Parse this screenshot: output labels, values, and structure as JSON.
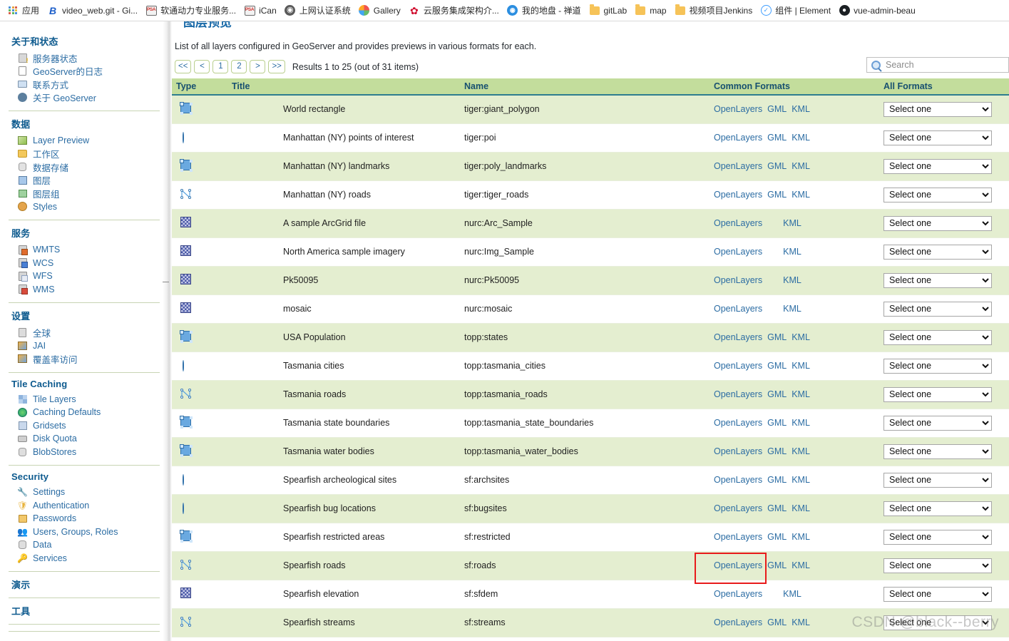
{
  "browser": {
    "bookmarks": [
      {
        "label": "应用",
        "icon": "apps-grid-icon"
      },
      {
        "label": "video_web.git - Gi...",
        "icon": "bitbucket-icon"
      },
      {
        "label": "软通动力专业服务...",
        "icon": "psa-icon"
      },
      {
        "label": "iCan",
        "icon": "psa-icon"
      },
      {
        "label": "上网认证系统",
        "icon": "globe-icon"
      },
      {
        "label": "Gallery",
        "icon": "gallery-icon"
      },
      {
        "label": "云服务集成架构介...",
        "icon": "huawei-icon"
      },
      {
        "label": "我的地盘 - 禅道",
        "icon": "chandao-icon"
      },
      {
        "label": "gitLab",
        "icon": "folder-icon"
      },
      {
        "label": "map",
        "icon": "folder-icon"
      },
      {
        "label": "视频项目Jenkins",
        "icon": "folder-icon"
      },
      {
        "label": "组件 | Element",
        "icon": "element-icon"
      },
      {
        "label": "vue-admin-beau",
        "icon": "github-icon"
      }
    ]
  },
  "sidebar": {
    "groups": [
      {
        "heading": "关于和状态",
        "items": [
          {
            "label": "服务器状态",
            "icon": "server-status-icon"
          },
          {
            "label": "GeoServer的日志",
            "icon": "document-icon"
          },
          {
            "label": "联系方式",
            "icon": "contact-card-icon"
          },
          {
            "label": "关于 GeoServer",
            "icon": "about-info-icon"
          }
        ]
      },
      {
        "heading": "数据",
        "items": [
          {
            "label": "Layer Preview",
            "icon": "layer-preview-icon"
          },
          {
            "label": "工作区",
            "icon": "workspace-folder-icon"
          },
          {
            "label": "数据存储",
            "icon": "datastore-icon"
          },
          {
            "label": "图层",
            "icon": "layer-icon"
          },
          {
            "label": "图层组",
            "icon": "layer-group-icon"
          },
          {
            "label": "Styles",
            "icon": "styles-palette-icon"
          }
        ]
      },
      {
        "heading": "服务",
        "items": [
          {
            "label": "WMTS",
            "icon": "service-wmts-icon"
          },
          {
            "label": "WCS",
            "icon": "service-wcs-icon"
          },
          {
            "label": "WFS",
            "icon": "service-wfs-icon"
          },
          {
            "label": "WMS",
            "icon": "service-wms-icon"
          }
        ]
      },
      {
        "heading": "设置",
        "items": [
          {
            "label": "全球",
            "icon": "global-settings-icon"
          },
          {
            "label": "JAI",
            "icon": "jai-icon"
          },
          {
            "label": "覆盖率访问",
            "icon": "coverage-access-icon"
          }
        ]
      },
      {
        "heading": "Tile Caching",
        "items": [
          {
            "label": "Tile Layers",
            "icon": "tile-layers-icon"
          },
          {
            "label": "Caching Defaults",
            "icon": "caching-defaults-icon"
          },
          {
            "label": "Gridsets",
            "icon": "gridsets-icon"
          },
          {
            "label": "Disk Quota",
            "icon": "disk-quota-icon"
          },
          {
            "label": "BlobStores",
            "icon": "blobstores-icon"
          }
        ]
      },
      {
        "heading": "Security",
        "items": [
          {
            "label": "Settings",
            "icon": "wrench-icon"
          },
          {
            "label": "Authentication",
            "icon": "shield-icon"
          },
          {
            "label": "Passwords",
            "icon": "lock-icon"
          },
          {
            "label": "Users, Groups, Roles",
            "icon": "users-icon"
          },
          {
            "label": "Data",
            "icon": "data-key-icon"
          },
          {
            "label": "Services",
            "icon": "services-key-icon"
          }
        ]
      },
      {
        "heading": "演示",
        "items": []
      },
      {
        "heading": "工具",
        "items": []
      }
    ]
  },
  "main": {
    "page_title": "图层预览",
    "description": "List of all layers configured in GeoServer and provides previews in various formats for each.",
    "pager": {
      "first": "<<",
      "prev": "<",
      "page1": "1",
      "page2": "2",
      "next": ">",
      "last": ">>",
      "results_text": "Results 1 to 25 (out of 31 items)"
    },
    "search": {
      "placeholder": "Search",
      "value": ""
    },
    "table": {
      "headers": [
        "Type",
        "Title",
        "Name",
        "Common Formats",
        "All Formats"
      ],
      "select_placeholder": "Select one",
      "rows": [
        {
          "type": "polygon",
          "title": "World rectangle",
          "name": "tiger:giant_polygon",
          "formats": [
            "OpenLayers",
            "GML",
            "KML"
          ],
          "select": "Select one"
        },
        {
          "type": "point",
          "title": "Manhattan (NY) points of interest",
          "name": "tiger:poi",
          "formats": [
            "OpenLayers",
            "GML",
            "KML"
          ],
          "select": "Select one"
        },
        {
          "type": "polygon",
          "title": "Manhattan (NY) landmarks",
          "name": "tiger:poly_landmarks",
          "formats": [
            "OpenLayers",
            "GML",
            "KML"
          ],
          "select": "Select one"
        },
        {
          "type": "line",
          "title": "Manhattan (NY) roads",
          "name": "tiger:tiger_roads",
          "formats": [
            "OpenLayers",
            "GML",
            "KML"
          ],
          "select": "Select one"
        },
        {
          "type": "raster",
          "title": "A sample ArcGrid file",
          "name": "nurc:Arc_Sample",
          "formats": [
            "OpenLayers",
            "KML"
          ],
          "select": "Select one"
        },
        {
          "type": "raster",
          "title": "North America sample imagery",
          "name": "nurc:Img_Sample",
          "formats": [
            "OpenLayers",
            "KML"
          ],
          "select": "Select one"
        },
        {
          "type": "raster",
          "title": "Pk50095",
          "name": "nurc:Pk50095",
          "formats": [
            "OpenLayers",
            "KML"
          ],
          "select": "Select one"
        },
        {
          "type": "raster",
          "title": "mosaic",
          "name": "nurc:mosaic",
          "formats": [
            "OpenLayers",
            "KML"
          ],
          "select": "Select one"
        },
        {
          "type": "polygon",
          "title": "USA Population",
          "name": "topp:states",
          "formats": [
            "OpenLayers",
            "GML",
            "KML"
          ],
          "select": "Select one"
        },
        {
          "type": "point",
          "title": "Tasmania cities",
          "name": "topp:tasmania_cities",
          "formats": [
            "OpenLayers",
            "GML",
            "KML"
          ],
          "select": "Select one"
        },
        {
          "type": "line",
          "title": "Tasmania roads",
          "name": "topp:tasmania_roads",
          "formats": [
            "OpenLayers",
            "GML",
            "KML"
          ],
          "select": "Select one"
        },
        {
          "type": "polygon",
          "title": "Tasmania state boundaries",
          "name": "topp:tasmania_state_boundaries",
          "formats": [
            "OpenLayers",
            "GML",
            "KML"
          ],
          "select": "Select one"
        },
        {
          "type": "polygon",
          "title": "Tasmania water bodies",
          "name": "topp:tasmania_water_bodies",
          "formats": [
            "OpenLayers",
            "GML",
            "KML"
          ],
          "select": "Select one"
        },
        {
          "type": "point",
          "title": "Spearfish archeological sites",
          "name": "sf:archsites",
          "formats": [
            "OpenLayers",
            "GML",
            "KML"
          ],
          "select": "Select one"
        },
        {
          "type": "point",
          "title": "Spearfish bug locations",
          "name": "sf:bugsites",
          "formats": [
            "OpenLayers",
            "GML",
            "KML"
          ],
          "select": "Select one"
        },
        {
          "type": "polygon",
          "title": "Spearfish restricted areas",
          "name": "sf:restricted",
          "formats": [
            "OpenLayers",
            "GML",
            "KML"
          ],
          "select": "Select one"
        },
        {
          "type": "line",
          "title": "Spearfish roads",
          "name": "sf:roads",
          "formats": [
            "OpenLayers",
            "GML",
            "KML"
          ],
          "select": "Select one"
        },
        {
          "type": "raster",
          "title": "Spearfish elevation",
          "name": "sf:sfdem",
          "formats": [
            "OpenLayers",
            "KML"
          ],
          "select": "Select one"
        },
        {
          "type": "line",
          "title": "Spearfish streams",
          "name": "sf:streams",
          "formats": [
            "OpenLayers",
            "GML",
            "KML"
          ],
          "select": "Select one"
        }
      ]
    }
  },
  "watermark": "CSDN @black--berry",
  "colors": {
    "header_green": "#c3dd9c",
    "row_odd": "#e4eed0",
    "link_blue": "#2b6ca3",
    "heading_blue": "#1a6aa8",
    "annotation_red": "#e81b1b"
  }
}
